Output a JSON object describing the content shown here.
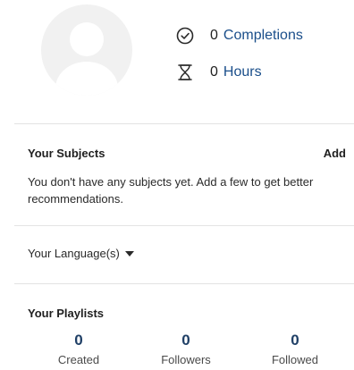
{
  "profile": {
    "completions": {
      "count": "0",
      "label": "Completions",
      "icon": "check-circle-icon"
    },
    "hours": {
      "count": "0",
      "label": "Hours",
      "icon": "hourglass-icon"
    }
  },
  "subjects": {
    "title": "Your Subjects",
    "add_label": "Add",
    "empty_text": "You don't have any subjects yet. Add a few to get better recommendations."
  },
  "languages": {
    "label": "Your Language(s)",
    "icon": "caret-down-icon"
  },
  "playlists": {
    "title": "Your Playlists",
    "stats": [
      {
        "value": "0",
        "label": "Created"
      },
      {
        "value": "0",
        "label": "Followers"
      },
      {
        "value": "0",
        "label": "Followed"
      }
    ]
  },
  "colors": {
    "link": "#1a4e8a",
    "stat_number": "#1f3f66",
    "divider": "#e3e3e3"
  }
}
